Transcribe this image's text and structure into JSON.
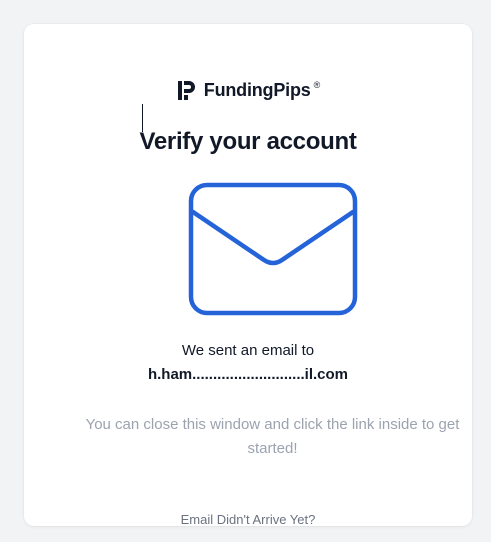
{
  "brand": {
    "name": "FundingPips",
    "reg_mark": "®",
    "logo_icon": "fundingpips-logo-icon"
  },
  "title": "Verify your account",
  "illustration": {
    "icon": "envelope-icon",
    "color": "#2563d9"
  },
  "message": {
    "sent_text": "We sent an email to",
    "email": "h.ham...........................il.com"
  },
  "info_text": "You can close this window and click the link inside to get started!",
  "resend_link": "Email Didn't Arrive Yet?",
  "colors": {
    "page_bg": "#f2f3f5",
    "card_bg": "#ffffff",
    "text_primary": "#111827",
    "text_muted": "#9ca3af",
    "link_muted": "#6b7280",
    "accent": "#2563d9"
  }
}
